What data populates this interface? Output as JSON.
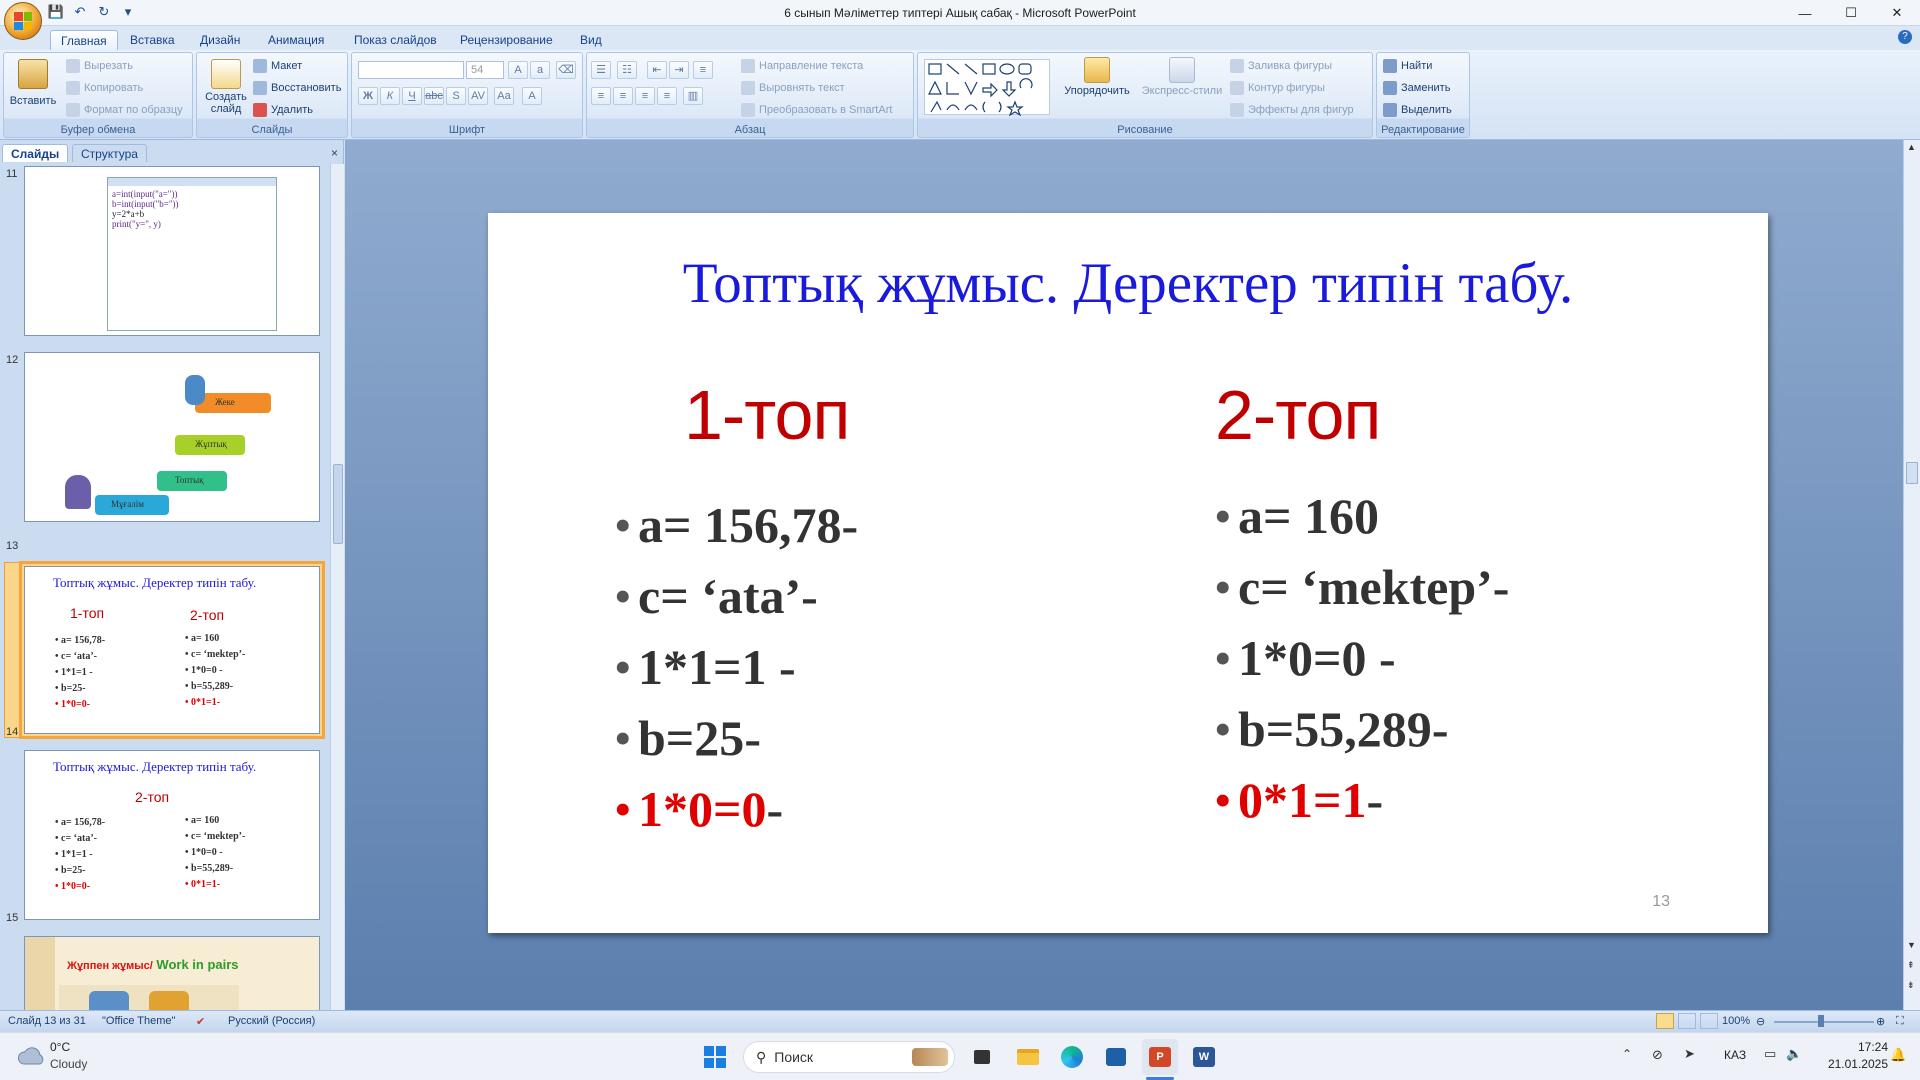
{
  "window": {
    "title": "6 сынып  Мәліметтер типтері Ашық сабақ - Microsoft PowerPoint",
    "qat_icons": [
      "save-icon",
      "undo-icon",
      "redo-icon",
      "customize-icon"
    ],
    "controls": {
      "minimize": "—",
      "maximize": "☐",
      "close": "✕"
    }
  },
  "ribbon_tabs": [
    "Главная",
    "Вставка",
    "Дизайн",
    "Анимация",
    "Показ слайдов",
    "Рецензирование",
    "Вид"
  ],
  "ribbon": {
    "clipboard": {
      "paste": "Вставить",
      "cut": "Вырезать",
      "copy": "Копировать",
      "format_painter": "Формат по образцу",
      "label": "Буфер обмена"
    },
    "slides": {
      "new_slide_1": "Создать",
      "new_slide_2": "слайд",
      "layout": "Макет",
      "reset": "Восстановить",
      "delete": "Удалить",
      "label": "Слайды"
    },
    "font": {
      "font_name": "",
      "font_size": "54",
      "label": "Шрифт"
    },
    "paragraph": {
      "text_direction": "Направление текста",
      "align_text": "Выровнять текст",
      "convert_smartart": "Преобразовать в SmartArt",
      "label": "Абзац"
    },
    "drawing": {
      "arrange": "Упорядочить",
      "quick_styles": "Экспресс-стили",
      "shape_fill": "Заливка фигуры",
      "shape_outline": "Контур фигуры",
      "shape_effects": "Эффекты для фигур",
      "label": "Рисование"
    },
    "editing": {
      "find": "Найти",
      "replace": "Заменить",
      "select": "Выделить",
      "label": "Редактирование"
    }
  },
  "pane": {
    "tab_slides": "Слайды",
    "tab_outline": "Структура",
    "close": "×",
    "thumbs": [
      {
        "num": "11",
        "code": [
          "a=int(input(\"a=\"))",
          "b=int(input(\"b=\"))",
          "y=2*a+b",
          "print(\"y=\", y)"
        ]
      },
      {
        "num": "12",
        "labels": [
          "Жеке",
          "Жұптық",
          "Топтық",
          "Мұғалім"
        ]
      },
      {
        "num": "13"
      },
      {
        "num": "14",
        "group": "2-топ"
      },
      {
        "num": "15",
        "title_kz": "Жұппен жұмыс/",
        "title_en": " Work in pairs"
      }
    ]
  },
  "slide": {
    "title": "Топтық жұмыс. Деректер типін табу.",
    "group1": "1-топ",
    "group2": "2-топ",
    "group1_items": [
      {
        "text": "a= 156,78",
        "dash": "-",
        "red": false
      },
      {
        "text": "c= ‘ata’",
        "dash": "-",
        "red": false
      },
      {
        "text": "1*1=1 ",
        "dash": " -",
        "red": false
      },
      {
        "text": "b=25",
        "dash": "-",
        "red": false
      },
      {
        "text": "1*0=0",
        "dash": "-",
        "red": true
      }
    ],
    "group2_items": [
      {
        "text": "a= 160",
        "dash": "",
        "red": false
      },
      {
        "text": "c= ‘mektep’",
        "dash": "-",
        "red": false
      },
      {
        "text": "1*0=0 ",
        "dash": " -",
        "red": false
      },
      {
        "text": "b=55,289",
        "dash": "-",
        "red": false
      },
      {
        "text": "0*1=1",
        "dash": "-",
        "red": true
      }
    ],
    "number": "13"
  },
  "status": {
    "slide_info": "Слайд 13 из 31",
    "theme": "\"Office Theme\"",
    "language": "Русский (Россия)",
    "zoom": "100%"
  },
  "taskbar": {
    "weather_temp": "0°C",
    "weather_desc": "Cloudy",
    "search_placeholder": "Поиск",
    "lang": "КАЗ",
    "time": "17:24",
    "date": "21.01.2025"
  },
  "colors": {
    "title_blue": "#1a1adb",
    "group_red": "#c00000",
    "bullet_red": "#e00000",
    "ribbon_text": "#15428b"
  }
}
